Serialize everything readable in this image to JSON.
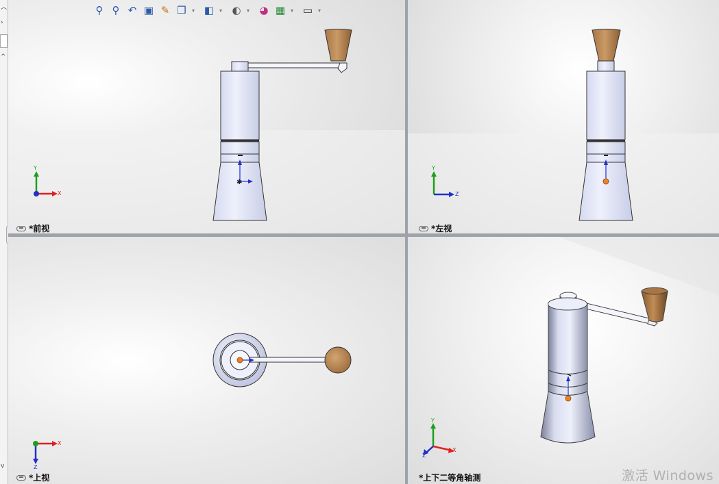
{
  "toolbar": {
    "buttons": [
      {
        "name": "zoom-to-fit-icon",
        "glyph": "⚲"
      },
      {
        "name": "zoom-to-area-icon",
        "glyph": "⚲"
      },
      {
        "name": "previous-view-icon",
        "glyph": "↶"
      },
      {
        "name": "section-view-icon",
        "glyph": "▣"
      },
      {
        "name": "dynamic-annotation-icon",
        "glyph": "✎"
      },
      {
        "name": "view-orientation-icon",
        "glyph": "❒"
      },
      {
        "name": "display-style-icon",
        "glyph": "◧"
      },
      {
        "name": "hide-show-items-icon",
        "glyph": "◐"
      },
      {
        "name": "edit-appearance-icon",
        "glyph": "◕"
      },
      {
        "name": "apply-scene-icon",
        "glyph": "▦"
      },
      {
        "name": "view-settings-icon",
        "glyph": "▭"
      }
    ]
  },
  "viewports": {
    "front": {
      "label": "*前视"
    },
    "left": {
      "label": "*左视"
    },
    "top": {
      "label": "*上视"
    },
    "iso": {
      "label": "*上下二等角轴测"
    }
  },
  "triad": {
    "x": "X",
    "y": "Y",
    "z": "Z"
  },
  "watermark": "激活 Windows",
  "colors": {
    "metal": "#e6e9f8",
    "wood": "#b98b5a",
    "axis_x": "#e02020",
    "axis_y": "#1e9e1e",
    "axis_z": "#2030c8",
    "origin": "#f08020"
  }
}
